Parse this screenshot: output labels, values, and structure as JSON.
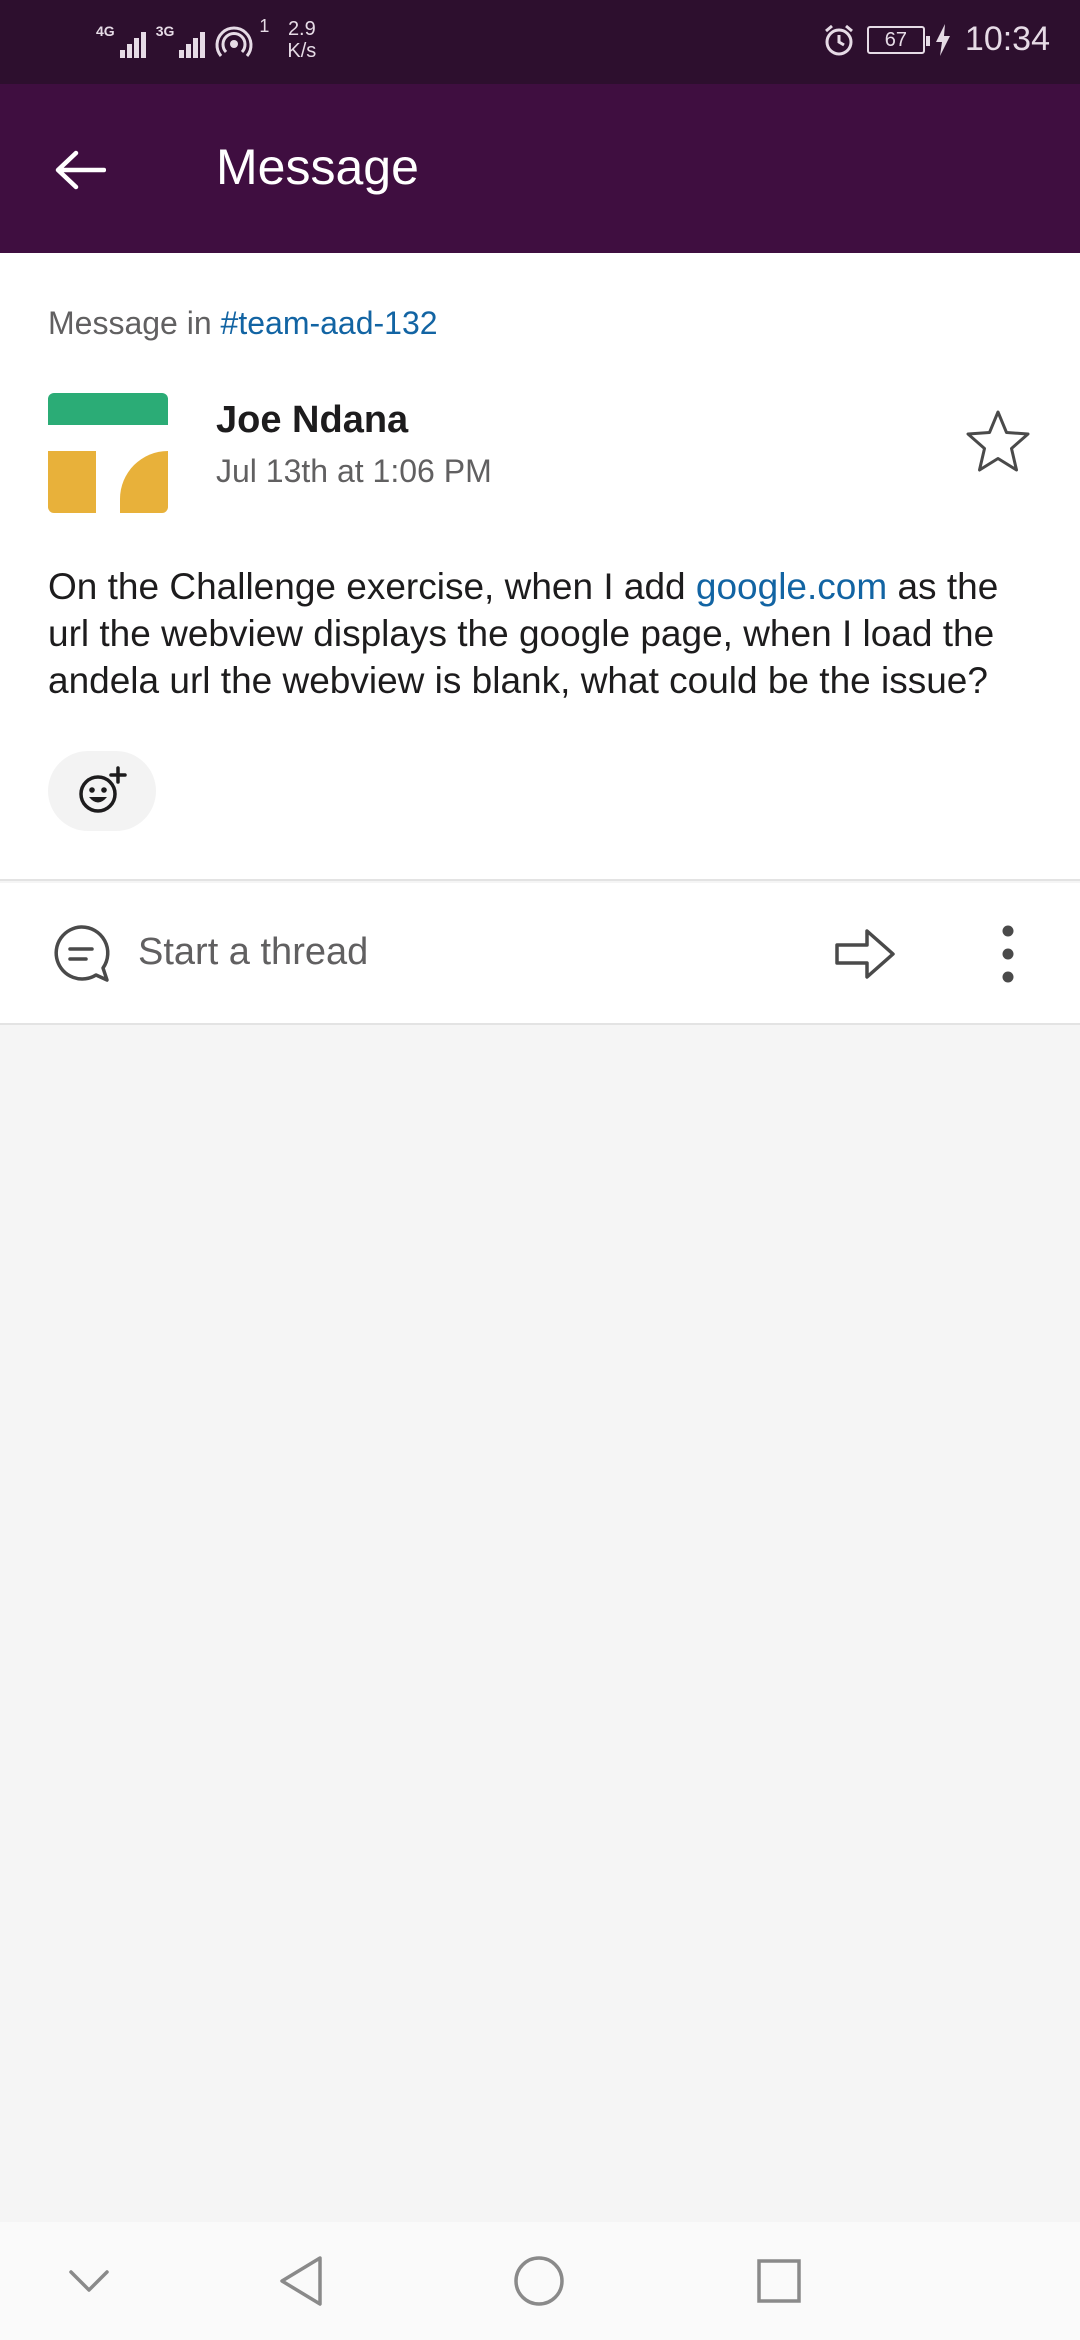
{
  "status_bar": {
    "network1": "4G",
    "network2": "3G",
    "hotspot_count": "1",
    "speed_value": "2.9",
    "speed_unit": "K/s",
    "battery": "67",
    "time": "10:34"
  },
  "header": {
    "title": "Message",
    "back_icon": "arrow-left-icon"
  },
  "message": {
    "channel_prefix": "Message in ",
    "channel_name": "#team-aad-132",
    "author": "Joe Ndana",
    "timestamp": "Jul 13th at 1:06 PM",
    "body_before_link": "On the Challenge exercise, when I add ",
    "link_text": "google.com",
    "body_after_link": " as the url the webview displays the google page, when I load the andela url the webview is blank, what could be the issue?",
    "star_icon": "star-outline-icon",
    "reaction_icon": "add-reaction-icon"
  },
  "thread_bar": {
    "label": "Start a thread",
    "thread_icon": "speech-bubble-icon",
    "share_icon": "share-arrow-icon",
    "more_icon": "more-vertical-icon"
  },
  "colors": {
    "status_bar_bg": "#2d0f2e",
    "header_bg": "#3f0e40",
    "link": "#1264a3",
    "avatar_green": "#2bac76",
    "avatar_yellow": "#e8b13a"
  },
  "nav_bar": {
    "icons": [
      "chevron-down-icon",
      "back-triangle-icon",
      "home-circle-icon",
      "recents-square-icon"
    ]
  }
}
